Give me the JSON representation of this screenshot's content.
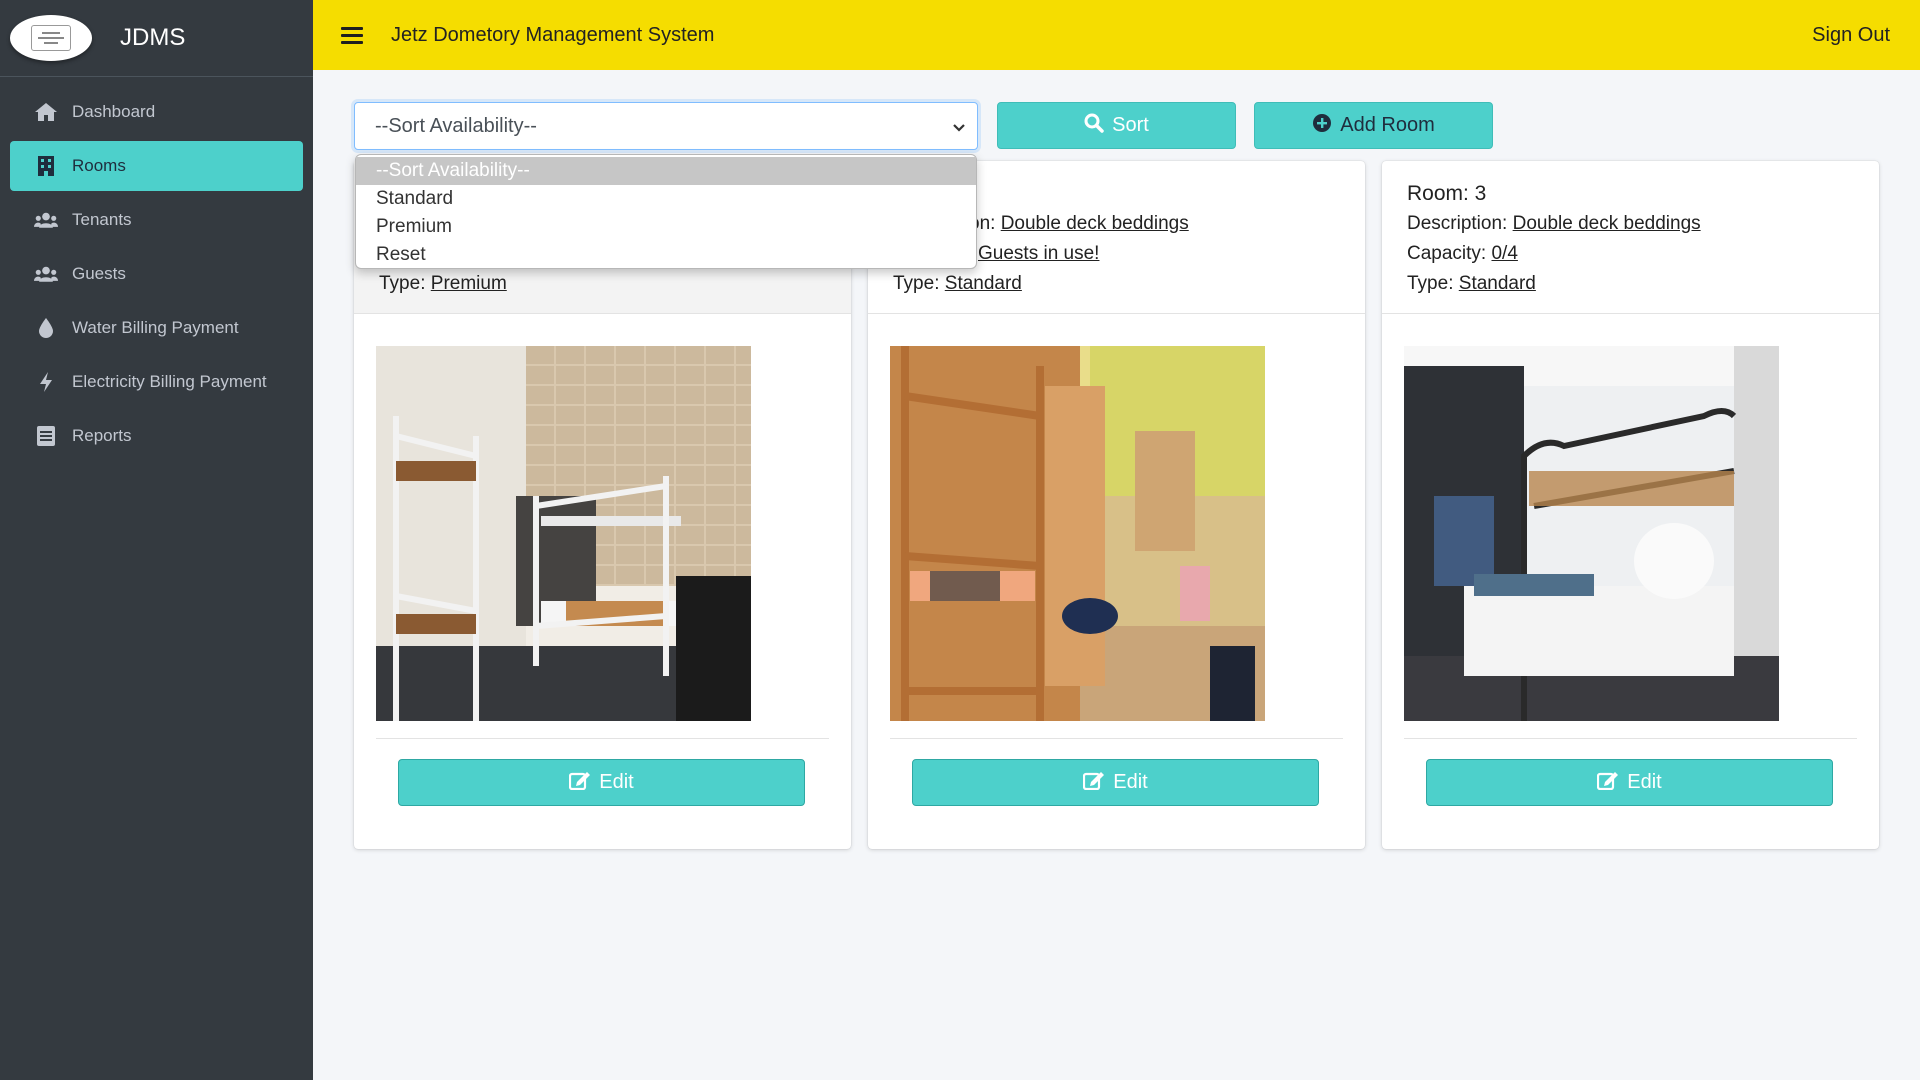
{
  "brand": {
    "name": "JDMS",
    "logo_icon": "dormitory-logo"
  },
  "header": {
    "title": "Jetz Dometory Management System",
    "signout_label": "Sign Out"
  },
  "colors": {
    "accent": "#4dd0cb",
    "header_bg": "#f5dd00",
    "sidebar_bg": "#343a40"
  },
  "sidebar": {
    "items": [
      {
        "label": "Dashboard",
        "icon": "home-icon"
      },
      {
        "label": "Rooms",
        "icon": "building-icon",
        "active": true
      },
      {
        "label": "Tenants",
        "icon": "users-icon"
      },
      {
        "label": "Guests",
        "icon": "users-icon"
      },
      {
        "label": "Water Billing Payment",
        "icon": "water-drop-icon"
      },
      {
        "label": "Electricity Billing Payment",
        "icon": "bolt-icon"
      },
      {
        "label": "Reports",
        "icon": "report-icon"
      }
    ]
  },
  "toolbar": {
    "select_value": "--Sort Availability--",
    "sort_label": "Sort",
    "add_label": "Add Room",
    "options": [
      "--Sort Availability--",
      "Standard",
      "Premium",
      "Reset"
    ]
  },
  "cards": [
    {
      "room": "",
      "description_label": "",
      "description": "",
      "capacity_label": "",
      "capacity": "",
      "type_label": "Type:",
      "type": "Premium",
      "edit_label": "Edit"
    },
    {
      "room": "",
      "description_label": "on:",
      "description": "Double deck beddings",
      "capacity_label": "",
      "capacity": "Guests in use!",
      "type_label": "Type:",
      "type": "Standard",
      "edit_label": "Edit"
    },
    {
      "room": "Room: 3",
      "description_label": "Description:",
      "description": "Double deck beddings",
      "capacity_label": "Capacity:",
      "capacity": "0/4",
      "type_label": "Type:",
      "type": "Standard",
      "edit_label": "Edit"
    }
  ]
}
